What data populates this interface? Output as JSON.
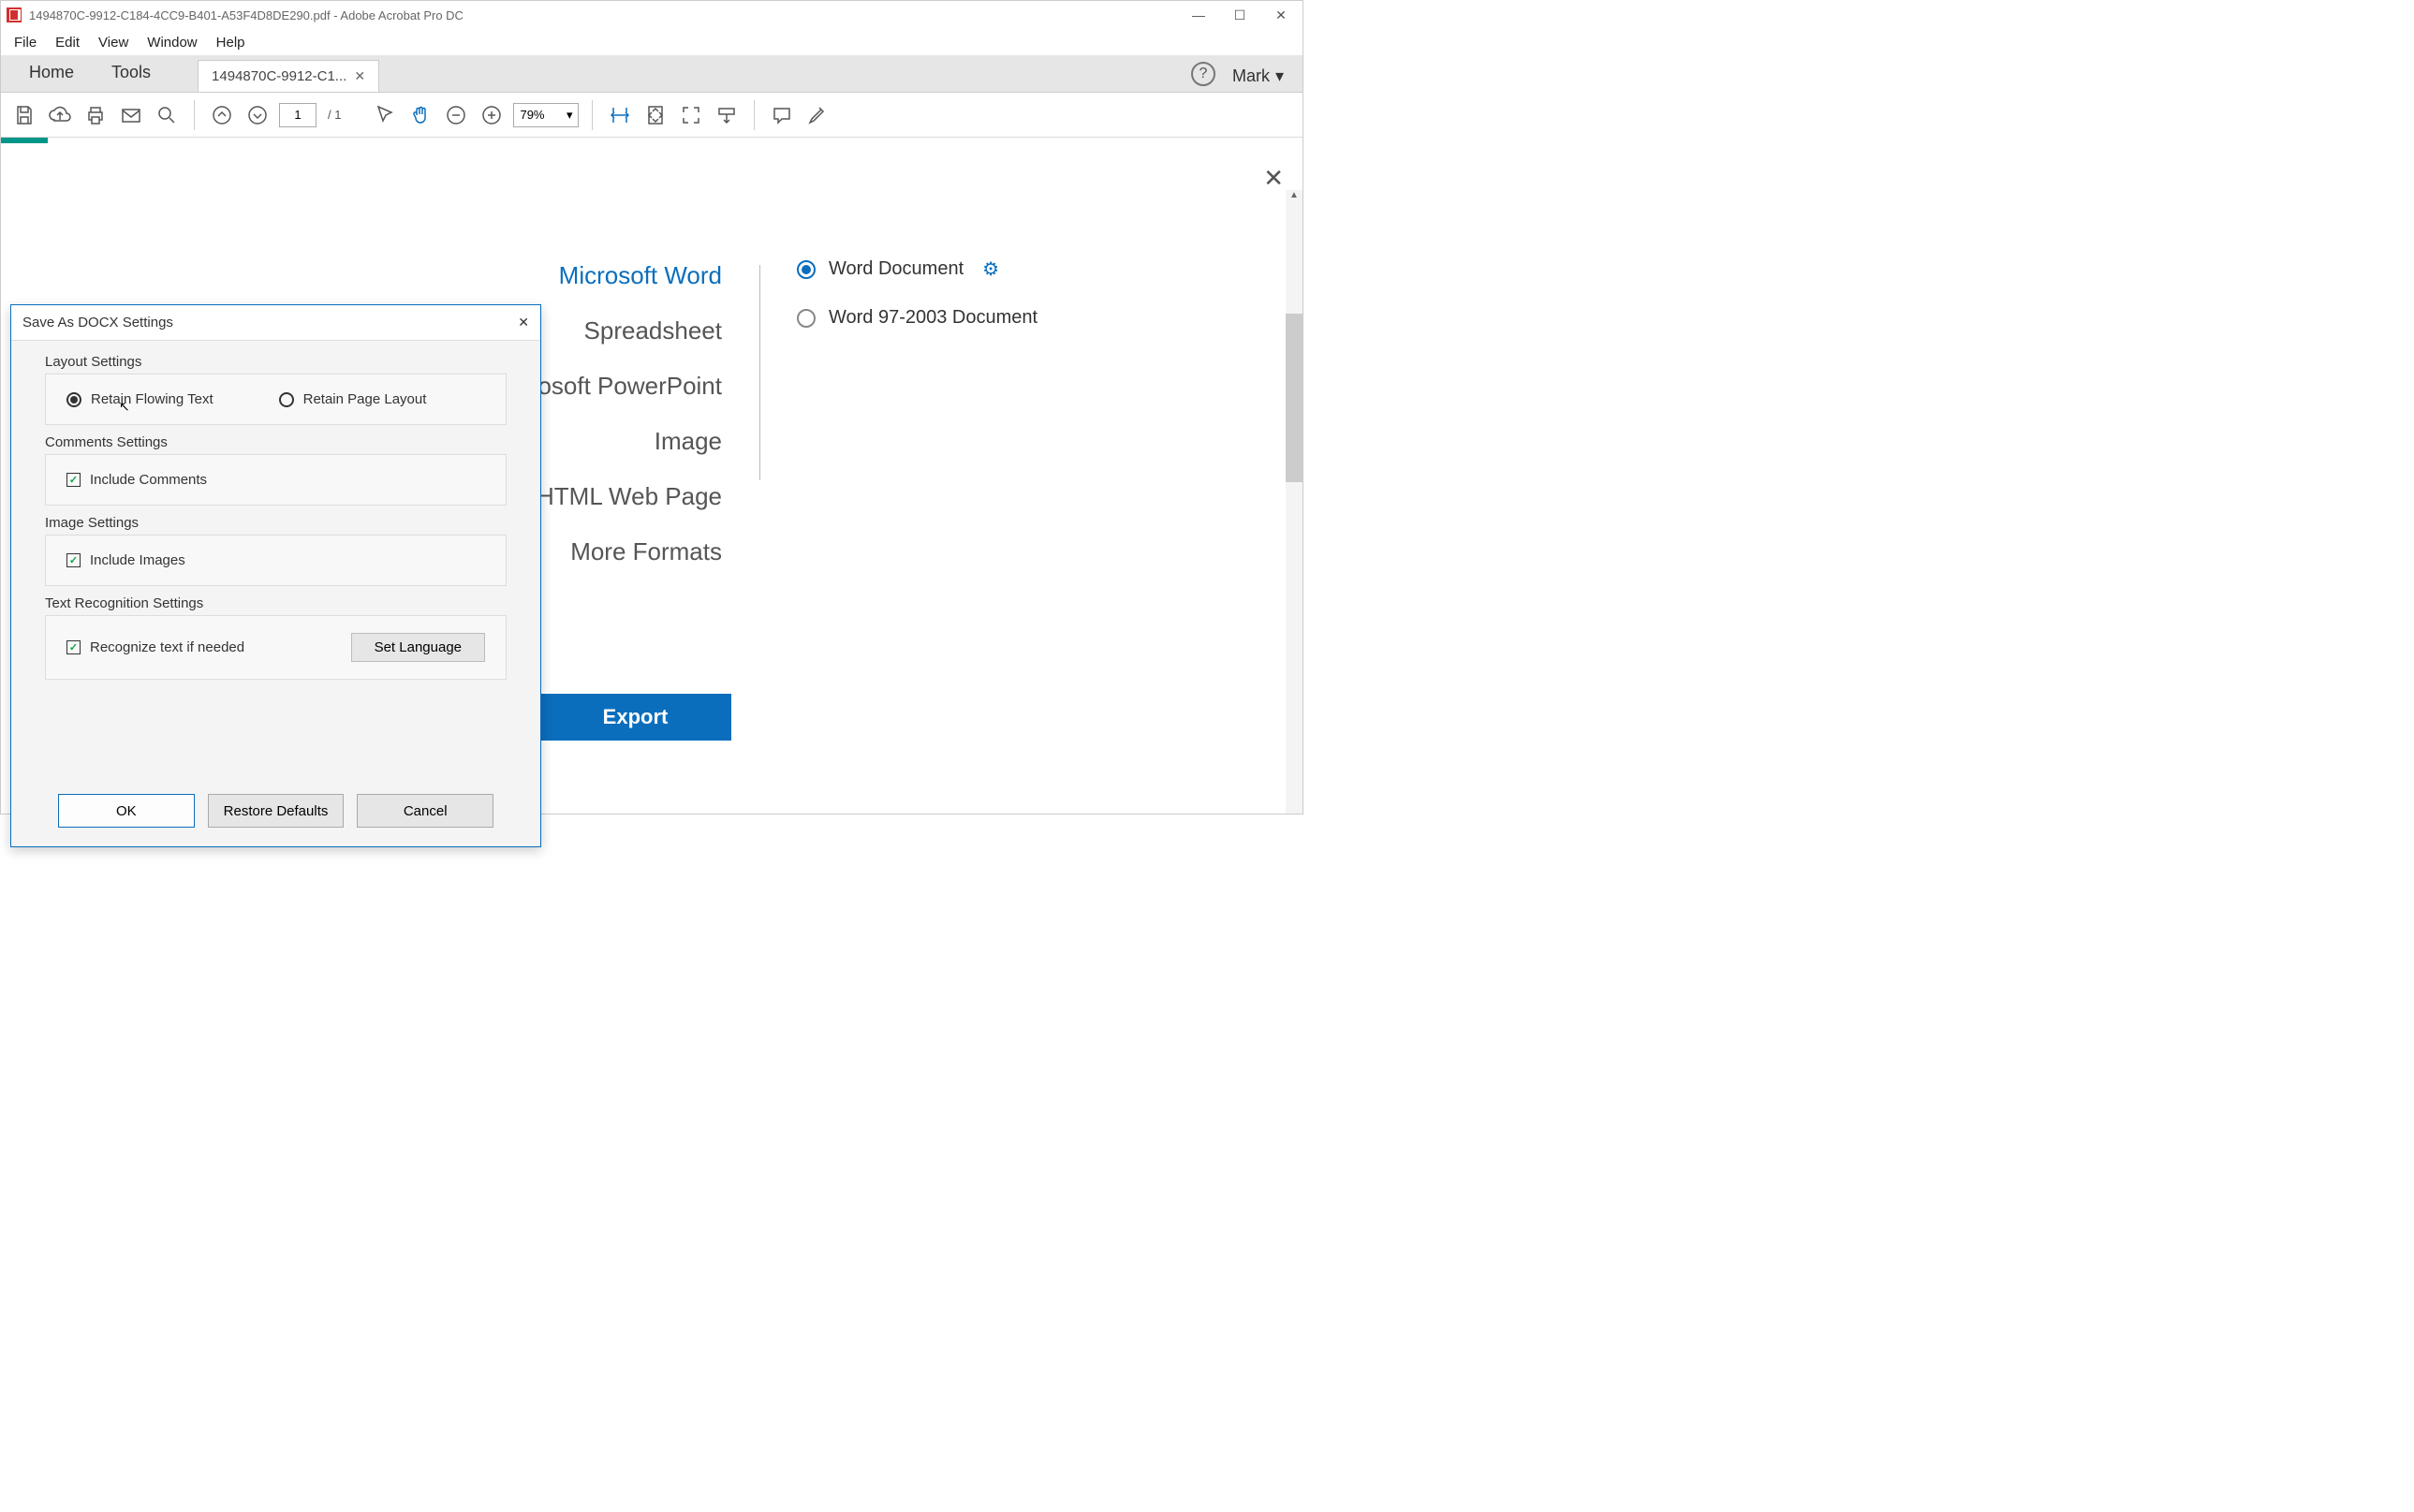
{
  "window": {
    "title": "1494870C-9912-C184-4CC9-B401-A53F4D8DE290.pdf - Adobe Acrobat Pro DC"
  },
  "menu": {
    "file": "File",
    "edit": "Edit",
    "view": "View",
    "window": "Window",
    "help": "Help"
  },
  "tabs": {
    "home": "Home",
    "tools": "Tools",
    "doc": "1494870C-9912-C1..."
  },
  "user": "Mark",
  "toolbar": {
    "page": "1",
    "pages": "/  1",
    "zoom": "79%"
  },
  "export": {
    "formats": [
      "Microsoft Word",
      "Spreadsheet",
      "osoft PowerPoint",
      "Image",
      "HTML Web Page",
      "More Formats"
    ],
    "selected_index": 0,
    "sub": {
      "word_doc": "Word Document",
      "word97": "Word 97-2003 Document"
    },
    "button": "Export"
  },
  "dialog": {
    "title": "Save As DOCX Settings",
    "layout_label": "Layout Settings",
    "retain_flowing": "Retain Flowing Text",
    "retain_page": "Retain Page Layout",
    "comments_label": "Comments Settings",
    "include_comments": "Include Comments",
    "image_label": "Image Settings",
    "include_images": "Include Images",
    "text_rec_label": "Text Recognition Settings",
    "recognize": "Recognize text if needed",
    "set_language": "Set Language",
    "ok": "OK",
    "restore": "Restore Defaults",
    "cancel": "Cancel"
  }
}
